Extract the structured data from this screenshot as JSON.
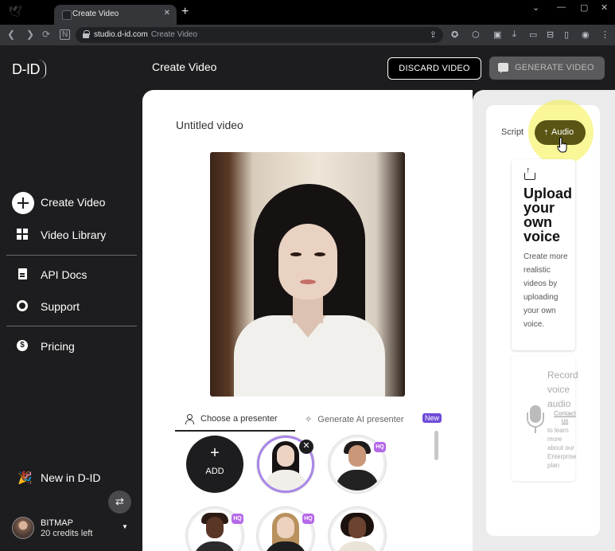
{
  "browser": {
    "tab_title": "Create Video",
    "url_host": "studio.d-id.com",
    "url_page": "Create Video"
  },
  "app": {
    "logo": "D-ID",
    "page_heading": "Create Video",
    "discard_label": "DISCARD VIDEO",
    "generate_label": "GENERATE VIDEO"
  },
  "sidebar": {
    "items": [
      {
        "label": "Create Video",
        "icon": "plus-circle-icon"
      },
      {
        "label": "Video Library",
        "icon": "grid-icon"
      },
      {
        "label": "API Docs",
        "icon": "document-icon"
      },
      {
        "label": "Support",
        "icon": "lifebuoy-icon"
      },
      {
        "label": "Pricing",
        "icon": "dollar-icon"
      }
    ],
    "new_in": "New in D-ID",
    "user": {
      "name": "BITMAP",
      "credits": "20 credits left"
    }
  },
  "main": {
    "video_title": "Untitled video",
    "tabs": [
      {
        "label": "Choose a presenter",
        "active": true
      },
      {
        "label": "Generate AI presenter",
        "badge": "New"
      }
    ],
    "add_label": "ADD",
    "hq_badge": "HQ"
  },
  "right_panel": {
    "tabs": [
      {
        "label": "Script",
        "active": false
      },
      {
        "label": "Audio",
        "active": true
      }
    ],
    "upload_title": "Upload your own voice",
    "upload_desc": "Create more realistic videos by uploading your own voice.",
    "record_title": "Record voice audio",
    "record_link": "Contact us",
    "record_note": "to learn more about our Enterprise plan"
  },
  "colors": {
    "sidebar_bg": "#1d1d1f",
    "accent_purple": "#a987e8",
    "audio_tab": "#5a5514",
    "highlight": "#f5f046"
  }
}
